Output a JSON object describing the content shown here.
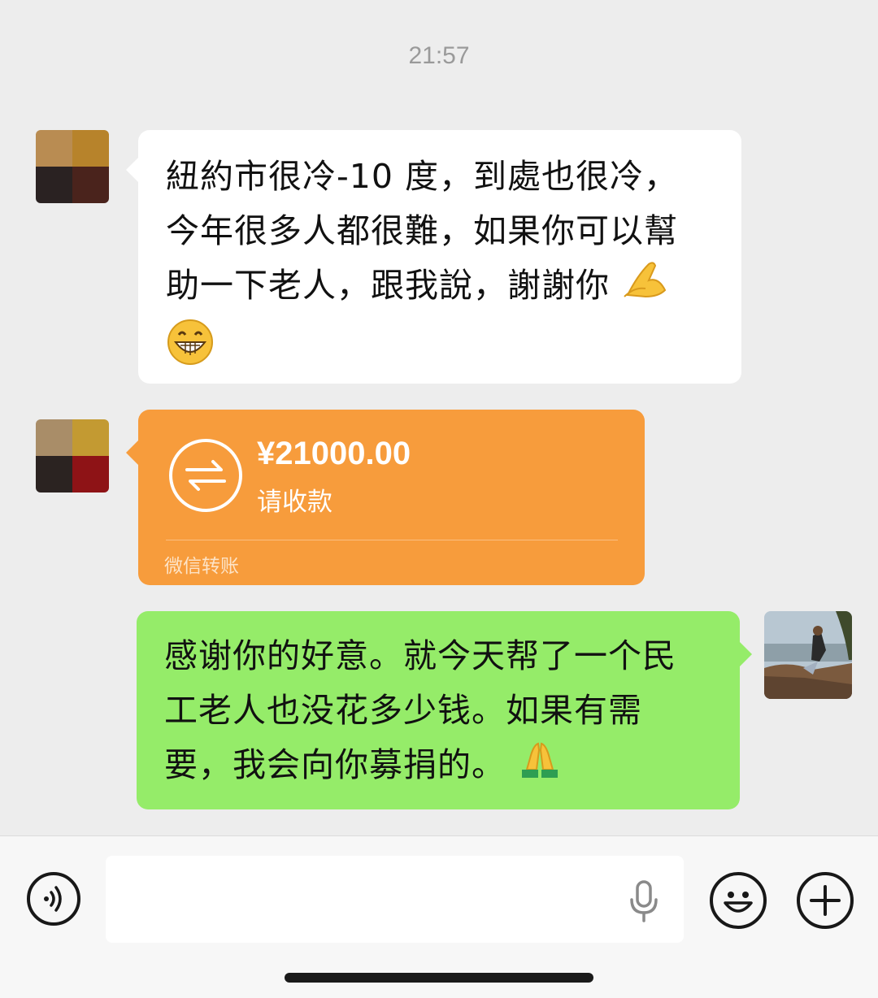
{
  "timestamp": "21:57",
  "messages": [
    {
      "type": "text",
      "direction": "incoming",
      "lines": [
        "紐約市很冷-10 度，到處也很冷，",
        "今年很多人都很難，如果你可以幫",
        "助一下老人，跟我說，謝謝你"
      ],
      "emojis": [
        "pinched-hands",
        "grinning-face"
      ],
      "bubble_color": "#ffffff"
    },
    {
      "type": "transfer",
      "direction": "incoming",
      "amount": "¥21000.00",
      "status": "请收款",
      "footer": "微信转账",
      "bubble_color": "#f79c3c",
      "icon": "transfer-arrows-icon"
    },
    {
      "type": "text",
      "direction": "outgoing",
      "lines": [
        "感谢你的好意。就今天帮了一个民",
        "工老人也没花多少钱。如果有需",
        "要，我会向你募捐的。"
      ],
      "emojis": [
        "folded-hands"
      ],
      "bubble_color": "#95ec69"
    }
  ],
  "input_bar": {
    "voice_icon": "voice-icon",
    "mic_icon": "microphone-icon",
    "emoji_icon": "emoji-icon",
    "plus_icon": "plus-icon",
    "text_value": ""
  },
  "colors": {
    "background": "#ededed",
    "transfer": "#f79c3c",
    "outgoing": "#95ec69"
  }
}
